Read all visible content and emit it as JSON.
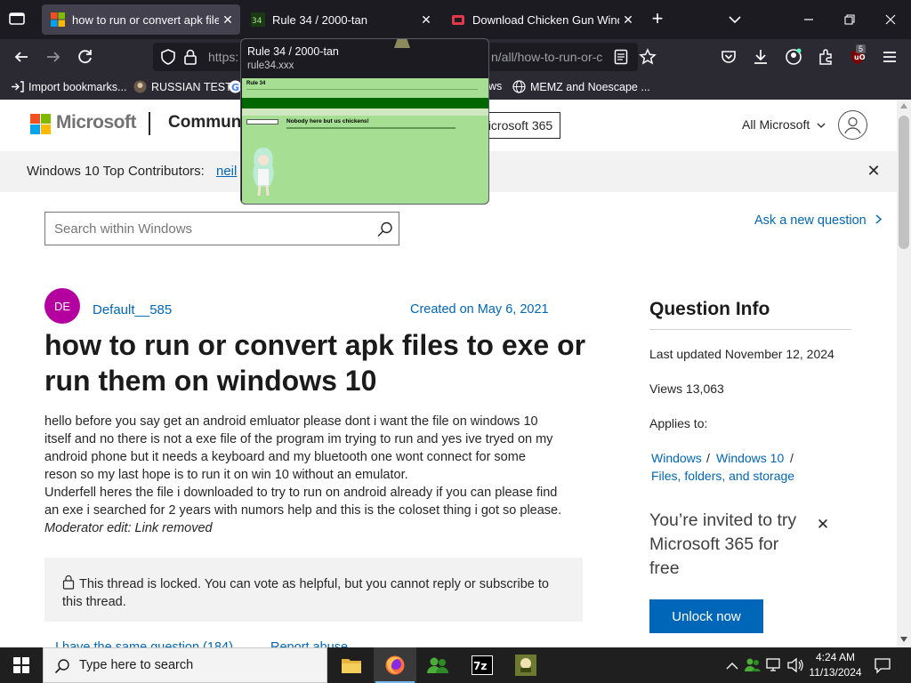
{
  "tabs": [
    {
      "label": "how to run or convert apk files t",
      "active": true
    },
    {
      "label": "Rule 34 / 2000-tan",
      "active": false
    },
    {
      "label": "Download Chicken Gun Windo",
      "active": false
    }
  ],
  "urlbar": {
    "prefix": "https:",
    "suffix": "n/all/how-to-run-or-c"
  },
  "extension_badge": "5",
  "bookmarks": [
    "Import bookmarks...",
    "RUSSIAN TEST",
    "ws",
    "MEMZ and Noescape ..."
  ],
  "tab_preview": {
    "title": "Rule 34 / 2000-tan",
    "url": "rule34.xxx",
    "thumb_heading": "Nobody here but us chickens!",
    "thumb_logo": "Rule 34"
  },
  "header": {
    "brand": "Microsoft",
    "section": "Communi",
    "m365_button": "icrosoft 365",
    "all_microsoft": "All Microsoft"
  },
  "banner": {
    "text": "Windows 10 Top Contributors:",
    "link": "neil"
  },
  "search": {
    "placeholder": "Search within Windows"
  },
  "ask_question": "Ask a new question",
  "question": {
    "avatar_initials": "DE",
    "author": "Default__585",
    "created": "Created on May 6, 2021",
    "title": "how to run or convert apk files to exe or run them on windows 10",
    "body_lines": [
      "hello before you say get an android emluator please dont i want the file on windows 10",
      "itself and no there is not a exe file of the program im trying to run and yes ive tryed on my",
      "android phone but it needs a keyboard and my bluetooth one wont connect for some",
      "reson so my last hope is to run it on win 10 without an emulator.",
      "Underfell heres the file i downloaded to try to run on android already if you can please find",
      "an exe i searched for 2 years with numors help and this is the coloset thing i got so please."
    ],
    "moderator_note": "Moderator edit: Link removed",
    "locked_text": "This thread is locked. You can vote as helpful, but you cannot reply or subscribe to this thread.",
    "same_question": "I have the same question (184)",
    "report_abuse": "Report abuse"
  },
  "question_info": {
    "heading": "Question Info",
    "last_updated": "Last updated November 12, 2024",
    "views": "Views 13,063",
    "applies_to_label": "Applies to:",
    "applies_to": [
      "Windows",
      "Windows 10",
      "Files, folders, and storage"
    ]
  },
  "promo": {
    "text": "You’re invited to try Microsoft 365 for free",
    "button": "Unlock now"
  },
  "taskbar": {
    "search_placeholder": "Type here to search",
    "time": "4:24 AM",
    "date": "11/13/2024"
  },
  "colors": {
    "ms_red": "#f25022",
    "ms_green": "#7fba00",
    "ms_blue": "#00a4ef",
    "ms_yellow": "#ffb900",
    "link_blue": "#0067b8",
    "avatar_magenta": "#b4009e"
  }
}
